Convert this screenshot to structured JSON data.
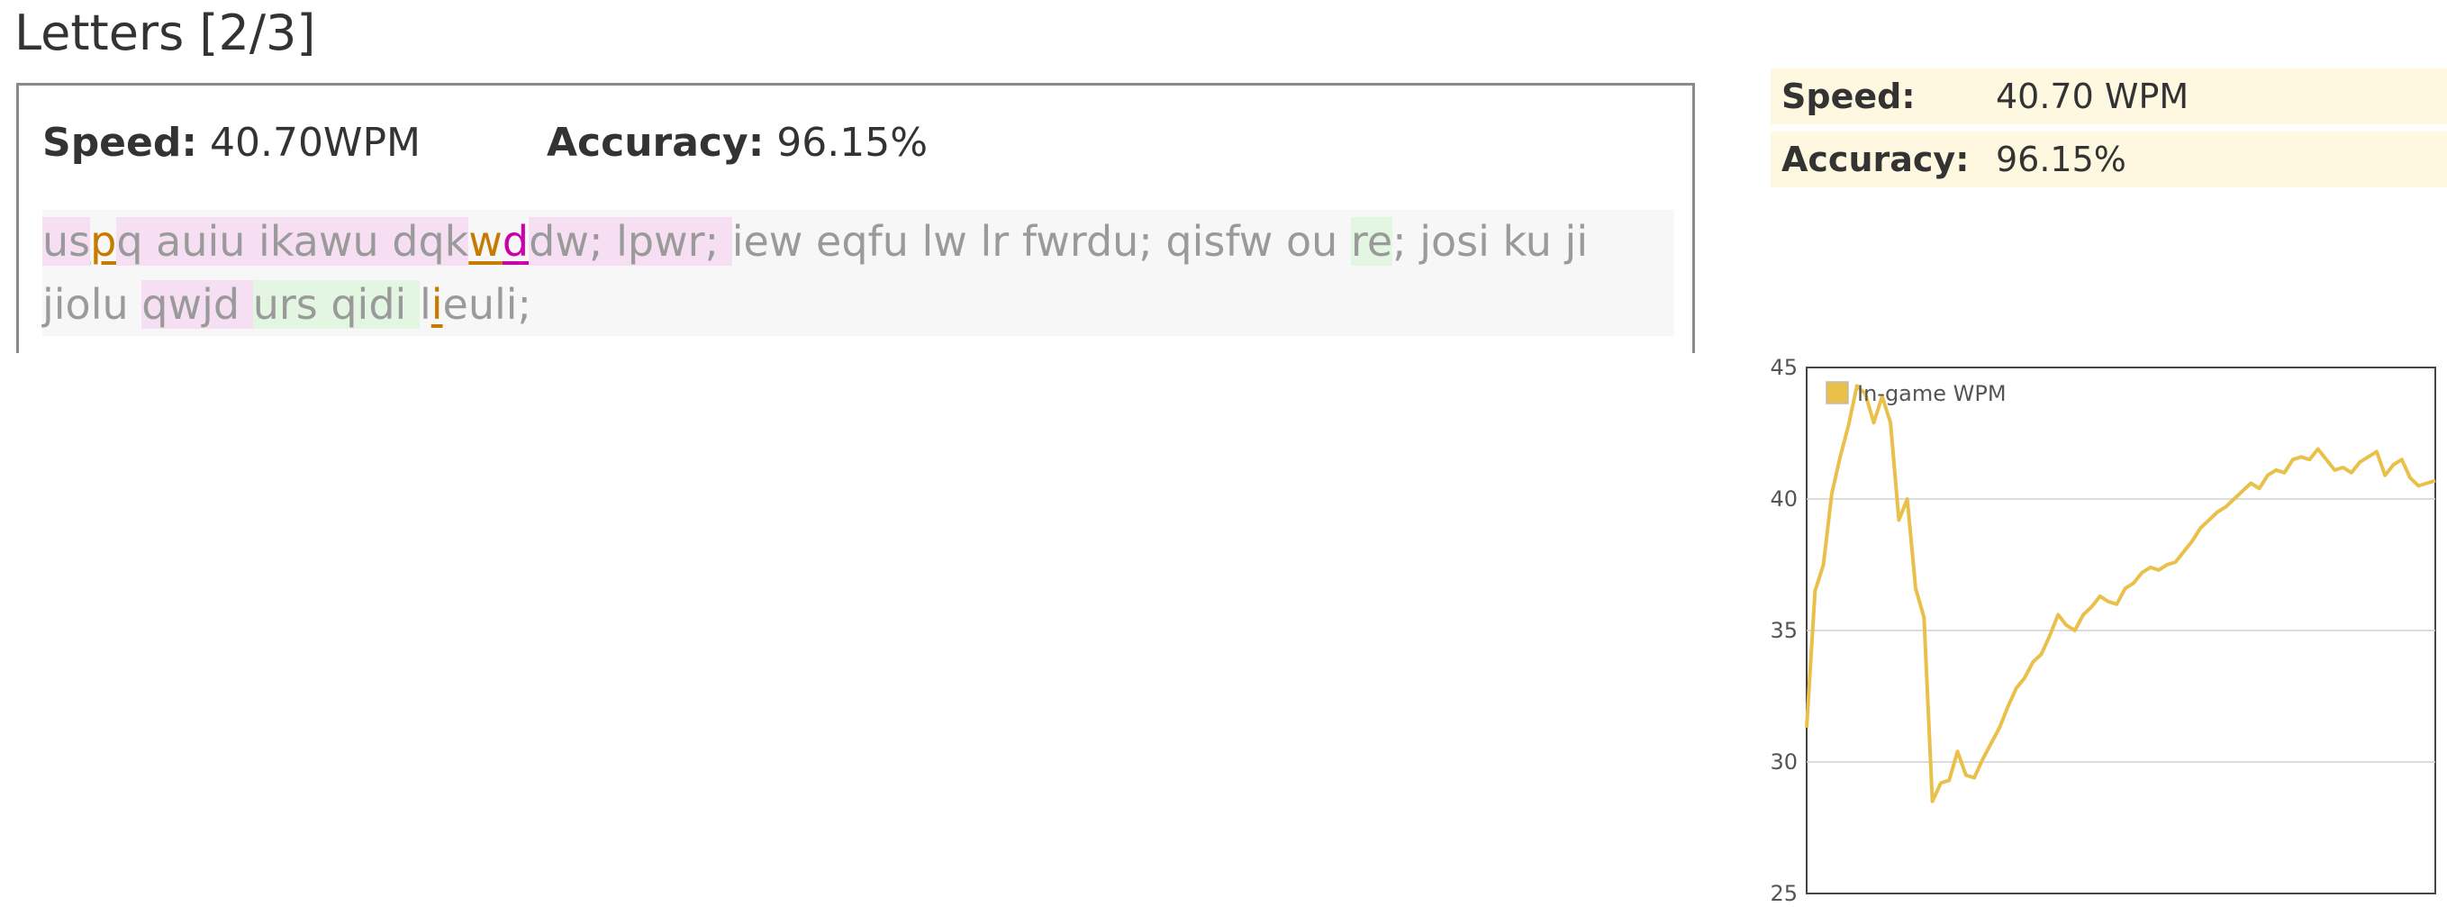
{
  "title": "Letters [2/3]",
  "stats": {
    "speed_label": "Speed:",
    "speed_value": "40.70WPM",
    "accuracy_label": "Accuracy:",
    "accuracy_value": "96.15%"
  },
  "text": {
    "segments": [
      {
        "t": "us",
        "s": "pink"
      },
      {
        "t": "p",
        "s": "err1"
      },
      {
        "t": "q auiu ikawu dqk",
        "s": "pink"
      },
      {
        "t": "w",
        "s": "err1"
      },
      {
        "t": "d",
        "s": "err2"
      },
      {
        "t": "dw; lpwr; ",
        "s": "pink"
      },
      {
        "t": "iew eqfu lw lr fwrdu; qisfw ou ",
        "s": ""
      },
      {
        "t": "re",
        "s": "grn"
      },
      {
        "t": "; josi ku ji jiolu ",
        "s": ""
      },
      {
        "t": "qwjd ",
        "s": "pink"
      },
      {
        "t": "urs qidi ",
        "s": "grn"
      },
      {
        "t": "l",
        "s": ""
      },
      {
        "t": "i",
        "s": "err1"
      },
      {
        "t": "euli;",
        "s": ""
      }
    ]
  },
  "summary": {
    "speed_label": "Speed:",
    "speed_value": "40.70 WPM",
    "accuracy_label": "Accuracy:",
    "accuracy_value": "96.15%"
  },
  "chart_data": {
    "type": "line",
    "title": "",
    "xlabel": "",
    "ylabel": "",
    "ylim": [
      25,
      45
    ],
    "yticks": [
      25,
      30,
      35,
      40,
      45
    ],
    "grid": true,
    "legend": "top-left",
    "series": [
      {
        "name": "In-game WPM",
        "color": "#e8c04a",
        "values": [
          31.3,
          36.5,
          37.5,
          40.2,
          41.6,
          42.8,
          44.3,
          44.0,
          42.9,
          43.9,
          42.9,
          39.2,
          40.0,
          36.6,
          35.5,
          28.5,
          29.2,
          29.3,
          30.4,
          29.5,
          29.4,
          30.1,
          30.7,
          31.3,
          32.1,
          32.8,
          33.2,
          33.8,
          34.1,
          34.8,
          35.6,
          35.2,
          35.0,
          35.6,
          35.9,
          36.3,
          36.1,
          36.0,
          36.6,
          36.8,
          37.2,
          37.4,
          37.3,
          37.5,
          37.6,
          38.0,
          38.4,
          38.9,
          39.2,
          39.5,
          39.7,
          40.0,
          40.3,
          40.6,
          40.4,
          40.9,
          41.1,
          41.0,
          41.5,
          41.6,
          41.5,
          41.9,
          41.5,
          41.1,
          41.2,
          41.0,
          41.4,
          41.6,
          41.8,
          40.9,
          41.3,
          41.5,
          40.8,
          40.5,
          40.6,
          40.7
        ]
      }
    ]
  },
  "colors": {
    "incorrect_word_bg": "#f6dff3",
    "correct_word_bg": "#e2f6e2",
    "typo_primary": "#c77a00",
    "typo_secondary": "#cc00aa",
    "summary_bg": "#fff8e1",
    "chart_line": "#e8c04a"
  }
}
